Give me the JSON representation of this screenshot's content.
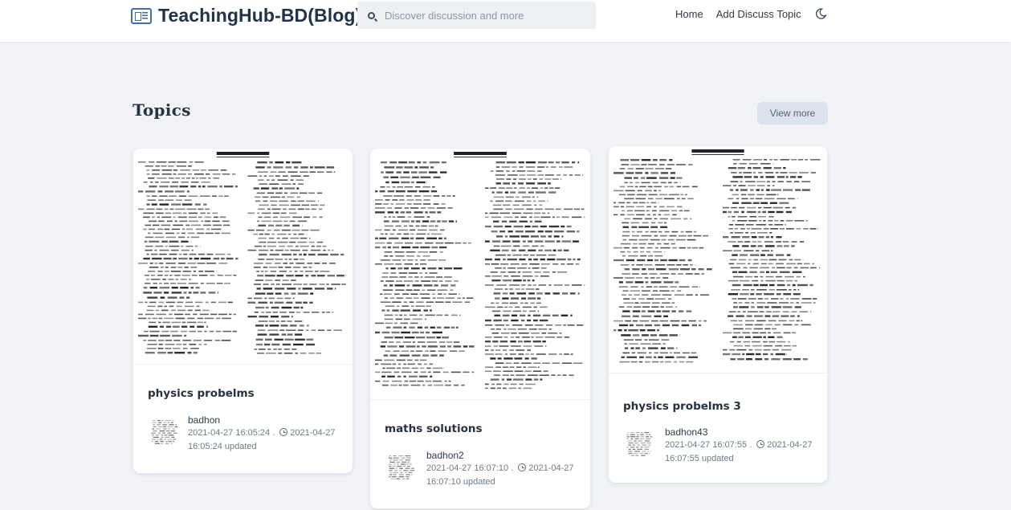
{
  "brand": {
    "name": "TeachingHub-BD(Blog)",
    "icon": "newspaper-icon",
    "color": "#3e6fb0"
  },
  "search": {
    "placeholder": "Discover discussion and more",
    "icon": "search-icon"
  },
  "nav": {
    "home": "Home",
    "add_topic": "Add Discuss Topic",
    "theme_icon": "moon-icon"
  },
  "section": {
    "title": "Topics",
    "view_more": "View more"
  },
  "cards": [
    {
      "title": "physics probelms",
      "author": "badhon",
      "created": "2021-04-27 16:05:24 .",
      "updated_line1": "2021-04-27",
      "updated_line2": "16:05:24 updated"
    },
    {
      "title": "maths solutions",
      "author": "badhon2",
      "created": "2021-04-27 16:07:10 .",
      "updated_line1": "2021-04-27",
      "updated_line2": "16:07:10 updated"
    },
    {
      "title": "physics probelms 3",
      "author": "badhon43",
      "created": "2021-04-27 16:07:55 .",
      "updated_line1": "2021-04-27",
      "updated_line2": "16:07:55 updated"
    }
  ]
}
